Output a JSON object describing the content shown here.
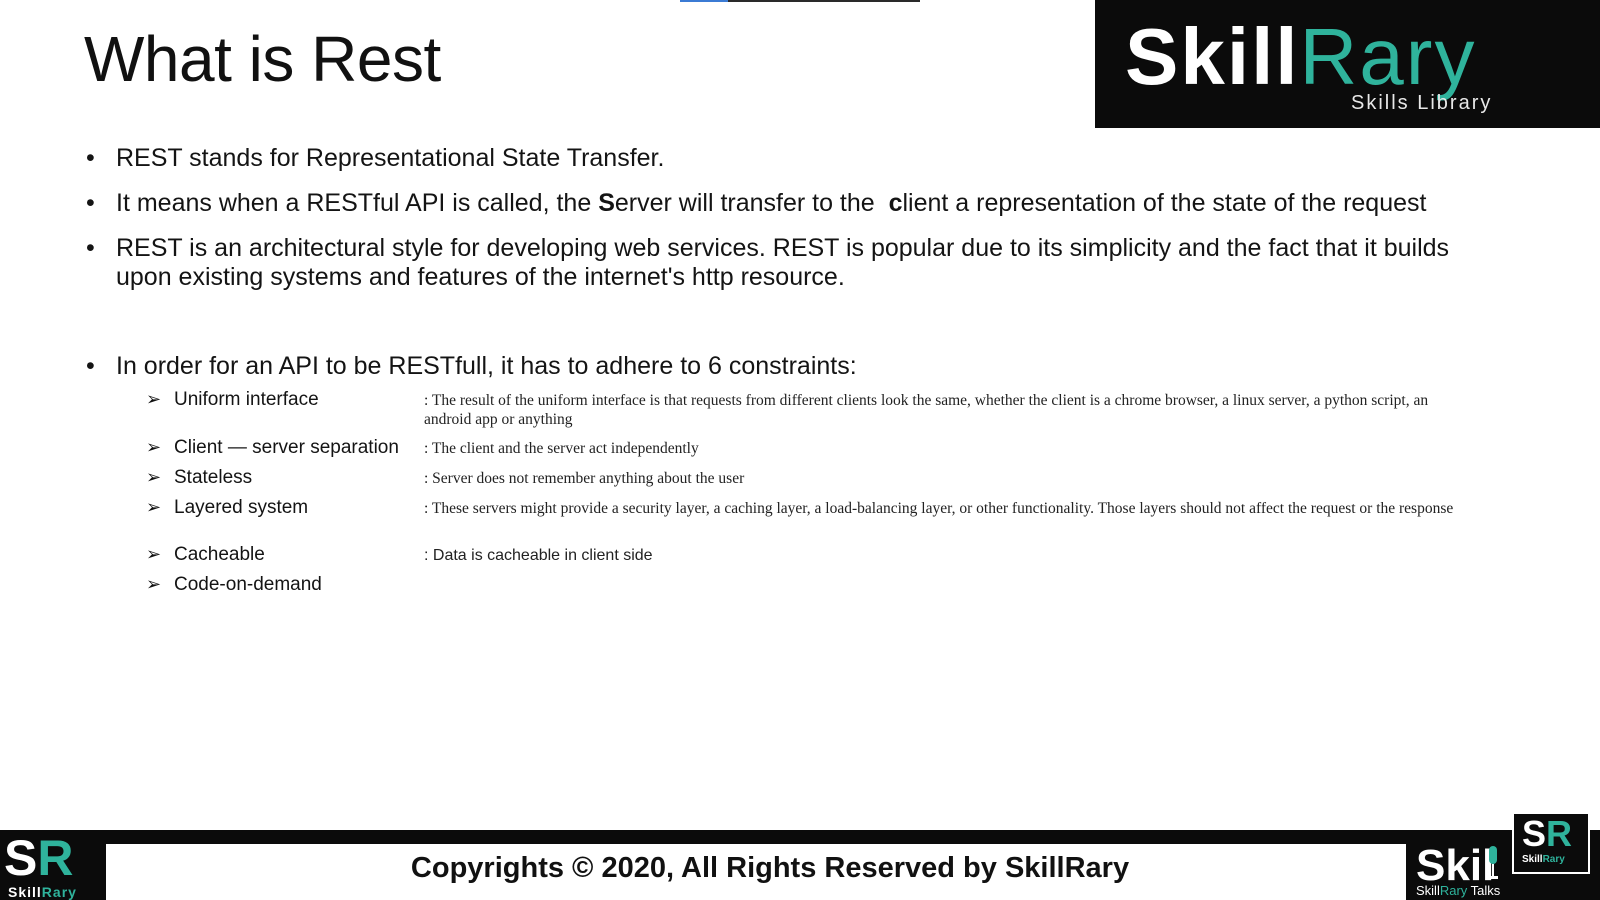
{
  "slide": {
    "title": "What is Rest",
    "bullets": [
      {
        "text": "REST stands for Representational State Transfer."
      },
      {
        "pre": "It means when a RESTful API is called, the ",
        "bold1": "S",
        "mid": "erver will transfer to the  ",
        "bold2": "c",
        "post": "lient a representation of the state of the request"
      },
      {
        "text": "REST is an architectural style for developing web services. REST is popular due to its simplicity and the fact that it builds upon existing systems and features of the internet's http resource."
      },
      {
        "text": "In order for an API to be RESTfull, it has to adhere to 6 constraints:"
      }
    ],
    "bullet_glyph": "•",
    "arrow_glyph": "➢",
    "constraints": [
      {
        "name": "Uniform interface",
        "desc": ": The result of the uniform interface is that requests from different clients look the same, whether the client is a chrome browser, a linux server, a python script, an android app or anything"
      },
      {
        "name": "Client — server separation",
        "desc": ": The client and the server act independently"
      },
      {
        "name": "Stateless",
        "desc": ": Server does not remember anything about the user"
      },
      {
        "name": "Layered system",
        "desc": ": These servers might provide a security layer, a caching layer, a load-balancing layer, or other functionality. Those layers should not affect the request or the response"
      },
      {
        "name": "Cacheable",
        "desc": ": Data is cacheable in client side"
      },
      {
        "name": "Code-on-demand",
        "desc": ""
      }
    ]
  },
  "logo": {
    "skill": "Skill",
    "rary": "Rary",
    "tagline": "Skills Library"
  },
  "footer": {
    "copyright": "Copyrights © 2020, All Rights Reserved by SkillRary",
    "sr_s": "S",
    "sr_r": "R",
    "sr_word_skill": "Skill",
    "sr_word_rary": "Rary",
    "talks_big": "Skil",
    "talks_skill": "Skill",
    "talks_rary": "Rary",
    "talks_word": " Talks"
  },
  "colors": {
    "brand_teal": "#2fb39c",
    "dark": "#0b0b0b"
  }
}
